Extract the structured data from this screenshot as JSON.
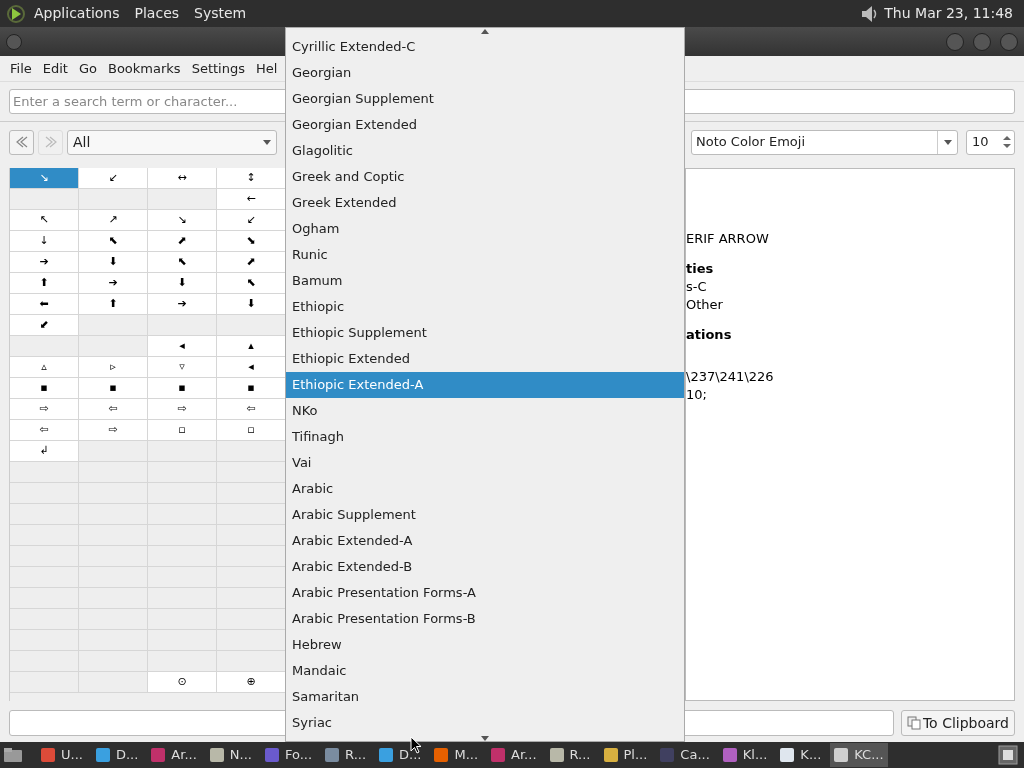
{
  "top_panel": {
    "menus": [
      "Applications",
      "Places",
      "System"
    ],
    "clock": "Thu Mar 23, 11:48"
  },
  "menu_bar": [
    "File",
    "Edit",
    "Go",
    "Bookmarks",
    "Settings",
    "Hel"
  ],
  "search": {
    "placeholder": "Enter a search term or character..."
  },
  "toolbar": {
    "category": "All",
    "font": "Noto Color Emoji",
    "size": "10"
  },
  "grid": [
    [
      {
        "char": "↘",
        "selected": true
      },
      {
        "char": "↙",
        "selected": false
      },
      {
        "char": "↔",
        "selected": false
      },
      {
        "char": "↕",
        "selected": false
      }
    ],
    [
      {
        "kind": "empty"
      },
      {
        "kind": "empty"
      },
      {
        "kind": "empty"
      },
      {
        "char": "←",
        "selected": false
      }
    ],
    [
      {
        "char": "↖",
        "selected": false
      },
      {
        "char": "↗",
        "selected": false
      },
      {
        "char": "↘",
        "selected": false
      },
      {
        "char": "↙",
        "selected": false
      }
    ],
    [
      {
        "char": "↓",
        "selected": false
      },
      {
        "char": "⬉",
        "selected": false
      },
      {
        "char": "⬈",
        "selected": false
      },
      {
        "char": "⬊",
        "selected": false
      }
    ],
    [
      {
        "char": "➔",
        "selected": false
      },
      {
        "char": "⬇",
        "selected": false
      },
      {
        "char": "⬉",
        "selected": false
      },
      {
        "char": "⬈",
        "selected": false
      }
    ],
    [
      {
        "char": "⬆",
        "selected": false
      },
      {
        "char": "➔",
        "selected": false
      },
      {
        "char": "⬇",
        "selected": false
      },
      {
        "char": "⬉",
        "selected": false
      }
    ],
    [
      {
        "char": "⬅",
        "selected": false
      },
      {
        "char": "⬆",
        "selected": false
      },
      {
        "char": "➔",
        "selected": false
      },
      {
        "char": "⬇",
        "selected": false
      }
    ],
    [
      {
        "char": "⬋",
        "selected": false
      },
      {
        "kind": "empty"
      },
      {
        "kind": "empty"
      },
      {
        "kind": "empty"
      }
    ],
    [
      {
        "kind": "empty"
      },
      {
        "kind": "empty"
      },
      {
        "char": "◂",
        "selected": false
      },
      {
        "char": "▴",
        "selected": false
      }
    ],
    [
      {
        "char": "▵",
        "selected": false
      },
      {
        "char": "▹",
        "selected": false
      },
      {
        "char": "▿",
        "selected": false
      },
      {
        "char": "◂",
        "selected": false
      }
    ],
    [
      {
        "char": "▪",
        "selected": false
      },
      {
        "char": "▪",
        "selected": false
      },
      {
        "char": "▪",
        "selected": false
      },
      {
        "char": "▪",
        "selected": false
      }
    ],
    [
      {
        "char": "⇨",
        "selected": false
      },
      {
        "char": "⇦",
        "selected": false
      },
      {
        "char": "⇨",
        "selected": false
      },
      {
        "char": "⇦",
        "selected": false
      }
    ],
    [
      {
        "char": "⇦",
        "selected": false
      },
      {
        "char": "⇨",
        "selected": false
      },
      {
        "char": "▫",
        "selected": false
      },
      {
        "char": "▫",
        "selected": false
      }
    ],
    [
      {
        "char": "↲",
        "selected": false
      },
      {
        "kind": "empty"
      },
      {
        "kind": "empty"
      },
      {
        "kind": "empty"
      }
    ],
    [
      {
        "kind": "empty"
      },
      {
        "kind": "empty"
      },
      {
        "kind": "empty"
      },
      {
        "kind": "empty"
      }
    ],
    [
      {
        "kind": "empty"
      },
      {
        "kind": "empty"
      },
      {
        "kind": "empty"
      },
      {
        "kind": "empty"
      }
    ],
    [
      {
        "kind": "empty"
      },
      {
        "kind": "empty"
      },
      {
        "kind": "empty"
      },
      {
        "kind": "empty"
      }
    ],
    [
      {
        "kind": "empty"
      },
      {
        "kind": "empty"
      },
      {
        "kind": "empty"
      },
      {
        "kind": "empty"
      }
    ],
    [
      {
        "kind": "empty"
      },
      {
        "kind": "empty"
      },
      {
        "kind": "empty"
      },
      {
        "kind": "empty"
      }
    ],
    [
      {
        "kind": "empty"
      },
      {
        "kind": "empty"
      },
      {
        "kind": "empty"
      },
      {
        "kind": "empty"
      }
    ],
    [
      {
        "kind": "empty"
      },
      {
        "kind": "empty"
      },
      {
        "kind": "empty"
      },
      {
        "kind": "empty"
      }
    ],
    [
      {
        "kind": "empty"
      },
      {
        "kind": "empty"
      },
      {
        "kind": "empty"
      },
      {
        "kind": "empty"
      }
    ],
    [
      {
        "kind": "empty"
      },
      {
        "kind": "empty"
      },
      {
        "kind": "empty"
      },
      {
        "kind": "empty"
      }
    ],
    [
      {
        "kind": "empty"
      },
      {
        "kind": "empty"
      },
      {
        "kind": "empty"
      },
      {
        "kind": "empty"
      }
    ],
    [
      {
        "kind": "empty"
      },
      {
        "kind": "empty"
      },
      {
        "char": "⊙",
        "selected": false
      },
      {
        "char": "⊕",
        "selected": false
      }
    ]
  ],
  "details": [
    {
      "kind": "text",
      "text": "ERIF ARROW"
    },
    {
      "kind": "gap"
    },
    {
      "kind": "heading",
      "text": "ties"
    },
    {
      "kind": "text",
      "text": "s-C"
    },
    {
      "kind": "text",
      "text": "Other"
    },
    {
      "kind": "gap"
    },
    {
      "kind": "heading",
      "text": "ations"
    },
    {
      "kind": "gap"
    },
    {
      "kind": "gap"
    },
    {
      "kind": "text",
      "text": "\\237\\241\\226"
    },
    {
      "kind": "text",
      "text": "10;"
    }
  ],
  "clipboard_button": "To Clipboard",
  "dropdown": [
    {
      "label": "Cyrillic Extended-C",
      "selected": false
    },
    {
      "label": "Georgian",
      "selected": false
    },
    {
      "label": "Georgian Supplement",
      "selected": false
    },
    {
      "label": "Georgian Extended",
      "selected": false
    },
    {
      "label": "Glagolitic",
      "selected": false
    },
    {
      "label": "Greek and Coptic",
      "selected": false
    },
    {
      "label": "Greek Extended",
      "selected": false
    },
    {
      "label": "Ogham",
      "selected": false
    },
    {
      "label": "Runic",
      "selected": false
    },
    {
      "label": "Bamum",
      "selected": false
    },
    {
      "label": "Ethiopic",
      "selected": false
    },
    {
      "label": "Ethiopic Supplement",
      "selected": false
    },
    {
      "label": "Ethiopic Extended",
      "selected": false
    },
    {
      "label": "Ethiopic Extended-A",
      "selected": true
    },
    {
      "label": "NKo",
      "selected": false
    },
    {
      "label": "Tifinagh",
      "selected": false
    },
    {
      "label": "Vai",
      "selected": false
    },
    {
      "label": "Arabic",
      "selected": false
    },
    {
      "label": "Arabic Supplement",
      "selected": false
    },
    {
      "label": "Arabic Extended-A",
      "selected": false
    },
    {
      "label": "Arabic Extended-B",
      "selected": false
    },
    {
      "label": "Arabic Presentation Forms-A",
      "selected": false
    },
    {
      "label": "Arabic Presentation Forms-B",
      "selected": false
    },
    {
      "label": "Hebrew",
      "selected": false
    },
    {
      "label": "Mandaic",
      "selected": false
    },
    {
      "label": "Samaritan",
      "selected": false
    },
    {
      "label": "Syriac",
      "selected": false
    }
  ],
  "taskbar": [
    {
      "label": "U...",
      "color": "#dd4b39",
      "selected": false
    },
    {
      "label": "D...",
      "color": "#3aa0e0",
      "selected": false
    },
    {
      "label": "Ar...",
      "color": "#c0306a",
      "selected": false
    },
    {
      "label": "N...",
      "color": "#b8b8a8",
      "selected": false
    },
    {
      "label": "Fo...",
      "color": "#6a5acd",
      "selected": false
    },
    {
      "label": "R...",
      "color": "#7a8ca0",
      "selected": false
    },
    {
      "label": "D...",
      "color": "#3aa0e0",
      "selected": false
    },
    {
      "label": "M...",
      "color": "#e66000",
      "selected": false
    },
    {
      "label": "Ar...",
      "color": "#c0306a",
      "selected": false
    },
    {
      "label": "R...",
      "color": "#b8b8a8",
      "selected": false
    },
    {
      "label": "Pl...",
      "color": "#d8b040",
      "selected": false
    },
    {
      "label": "Ca...",
      "color": "#404060",
      "selected": false
    },
    {
      "label": "Kl...",
      "color": "#b060c0",
      "selected": false
    },
    {
      "label": "K...",
      "color": "#dfe6ee",
      "selected": false
    },
    {
      "label": "KC...",
      "color": "#cfcfcf",
      "selected": true
    }
  ]
}
